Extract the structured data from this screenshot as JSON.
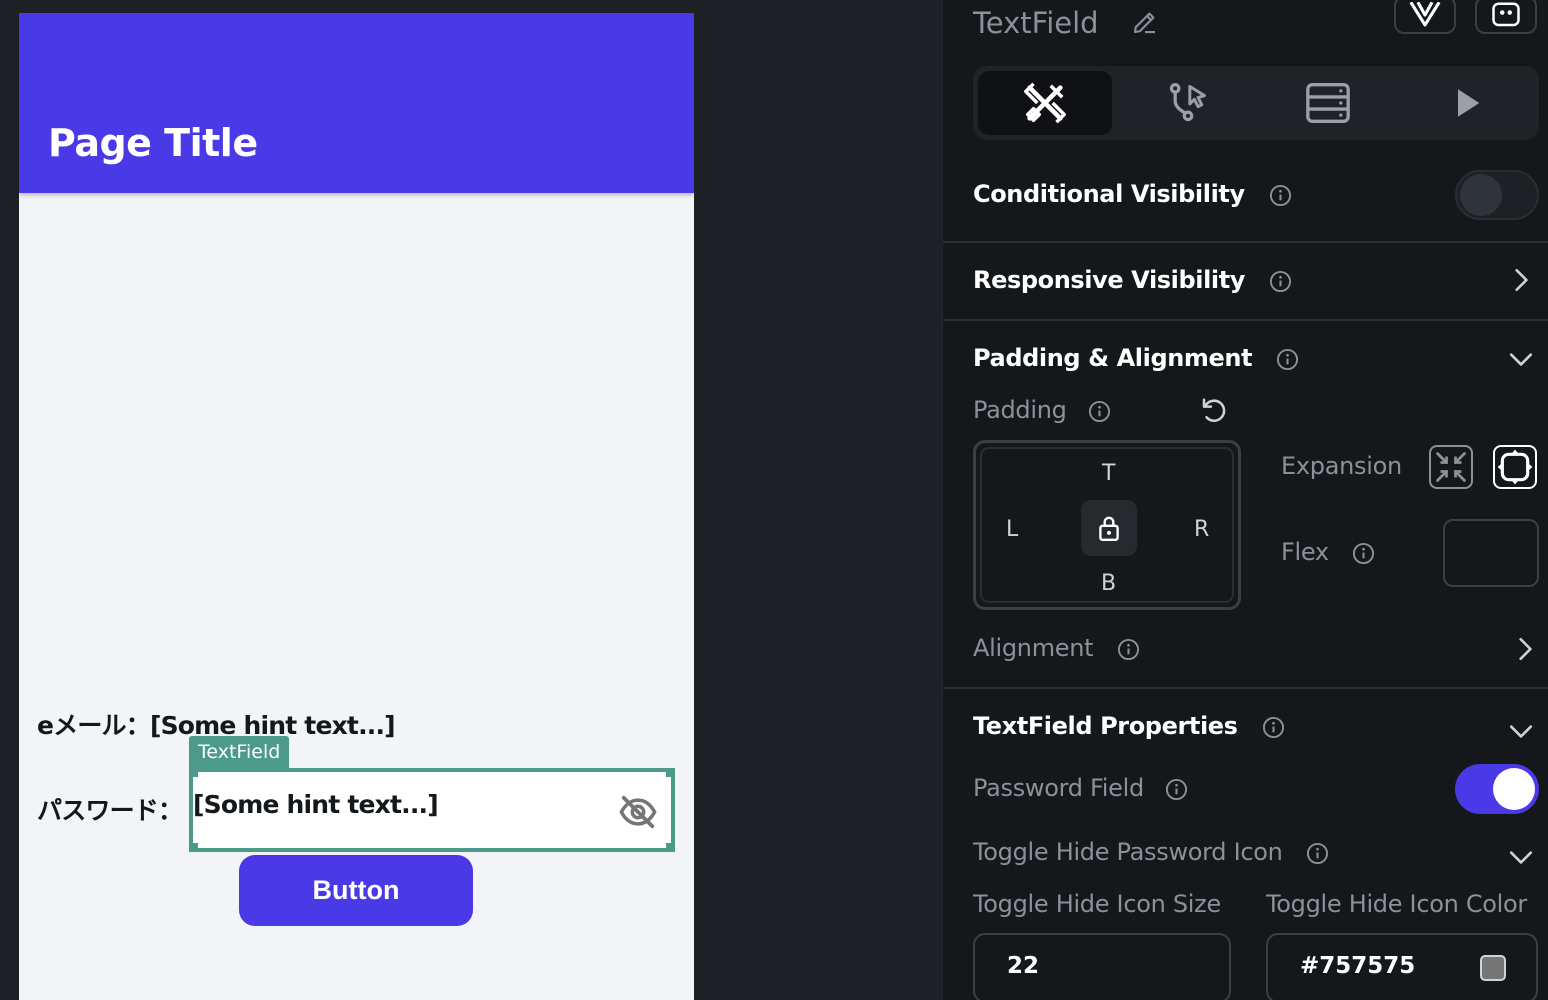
{
  "canvas": {
    "page_title": "Page Title",
    "email_row": "eメール：[Some hint text...]",
    "password_label": "パスワード：",
    "textfield_tag": "TextField",
    "password_hint": "[Some hint text...]",
    "button_label": "Button",
    "colors": {
      "appbar": "#4a39e6",
      "selection": "#4b9a8a",
      "background": "#f2f4f8"
    }
  },
  "panel": {
    "widget_title": "TextField",
    "top_buttons": [
      "gem-icon",
      "widget-icon"
    ],
    "tabs": [
      {
        "icon": "properties-icon",
        "active": true
      },
      {
        "icon": "actions-icon",
        "active": false
      },
      {
        "icon": "backend-query-icon",
        "active": false
      },
      {
        "icon": "play-icon",
        "active": false
      }
    ],
    "conditional_visibility": {
      "label": "Conditional Visibility",
      "enabled": false
    },
    "responsive_visibility": {
      "label": "Responsive Visibility"
    },
    "padding_alignment": {
      "title": "Padding & Alignment",
      "padding_label": "Padding",
      "sides": {
        "top": "T",
        "left": "L",
        "right": "R",
        "bottom": "B"
      },
      "expansion_label": "Expansion",
      "flex_label": "Flex",
      "flex_value": "",
      "alignment_label": "Alignment"
    },
    "textfield_properties": {
      "title": "TextField Properties",
      "password_field_label": "Password Field",
      "password_field_enabled": true,
      "toggle_hide_label": "Toggle Hide Password Icon",
      "icon_size_label": "Toggle Hide Icon Size",
      "icon_size_value": "22",
      "icon_color_label": "Toggle Hide Icon Color",
      "icon_color_value": "#757575",
      "icon_color": "#757575"
    },
    "accent_color": "#4a39e6"
  }
}
